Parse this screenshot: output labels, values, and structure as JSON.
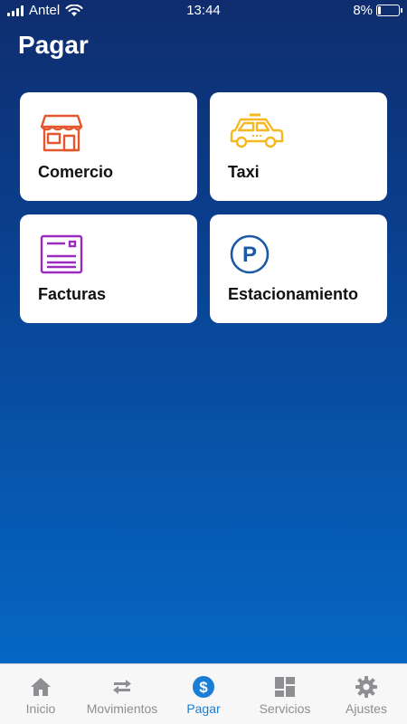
{
  "status_bar": {
    "carrier": "Antel",
    "time": "13:44",
    "battery": "8%"
  },
  "page": {
    "title": "Pagar"
  },
  "cards": [
    {
      "label": "Comercio",
      "icon": "store-icon"
    },
    {
      "label": "Taxi",
      "icon": "taxi-icon"
    },
    {
      "label": "Facturas",
      "icon": "invoice-icon"
    },
    {
      "label": "Estacionamiento",
      "icon": "parking-icon"
    }
  ],
  "tab_bar": {
    "items": [
      {
        "label": "Inicio",
        "icon": "home-icon"
      },
      {
        "label": "Movimientos",
        "icon": "transfer-arrows-icon"
      },
      {
        "label": "Pagar",
        "icon": "dollar-icon",
        "active": true
      },
      {
        "label": "Servicios",
        "icon": "grid-icon"
      },
      {
        "label": "Ajustes",
        "icon": "gear-icon"
      }
    ]
  },
  "colors": {
    "store": "#e4572e",
    "taxi": "#f6b820",
    "invoice": "#9a2bbf",
    "parking": "#1c5aa6",
    "tab_active": "#1a7ed6",
    "tab_inactive": "#8e8e93"
  }
}
